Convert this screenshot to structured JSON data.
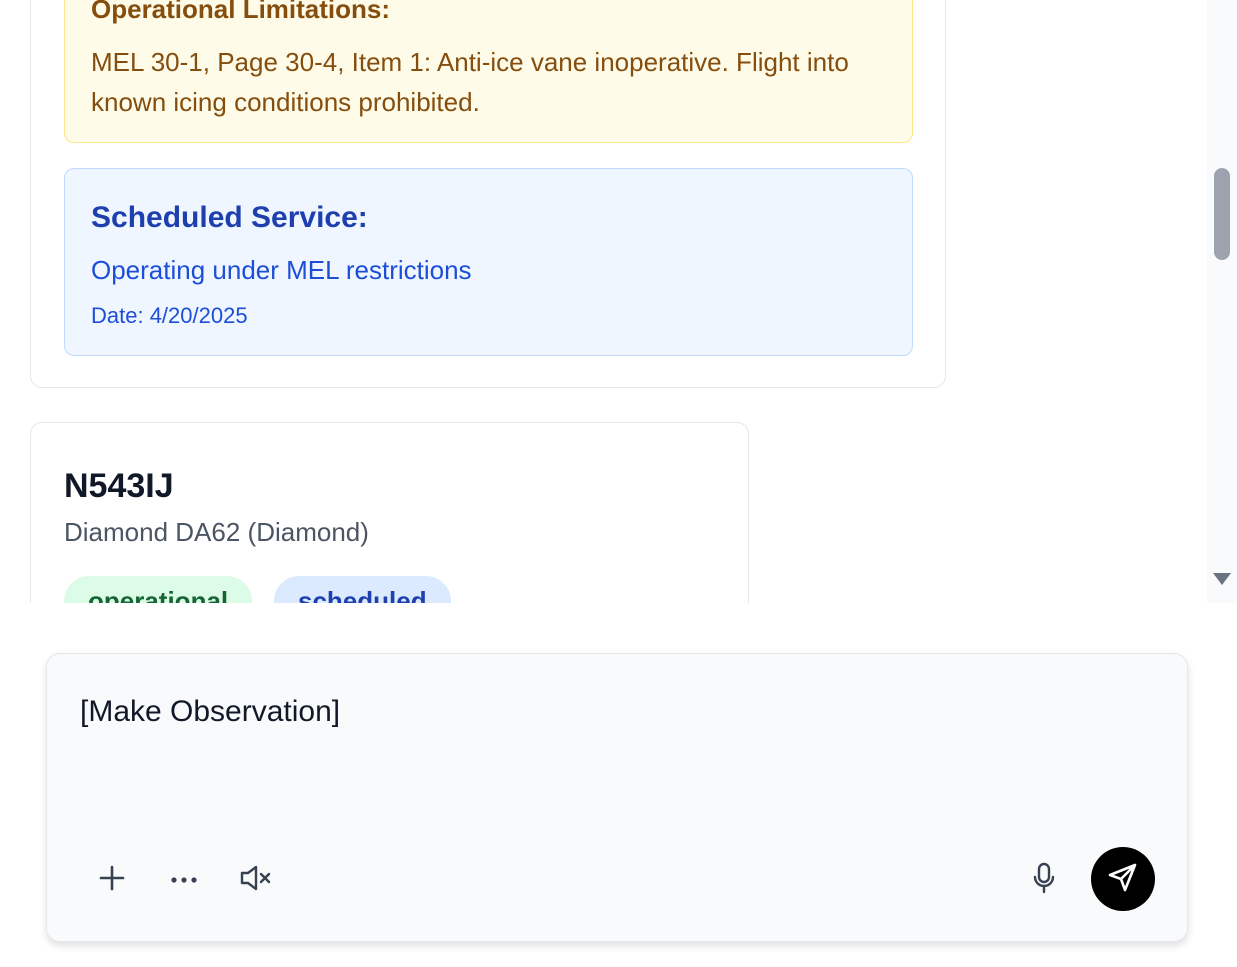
{
  "limitations": {
    "title": "Operational Limitations:",
    "text": "MEL 30-1, Page 30-4, Item 1: Anti-ice vane inoperative. Flight into known icing conditions prohibited."
  },
  "service": {
    "title": "Scheduled Service:",
    "text": "Operating under MEL restrictions",
    "date": "Date: 4/20/2025"
  },
  "aircraft": {
    "tail": "N543IJ",
    "model": "Diamond DA62 (Diamond)",
    "badges": [
      "operational",
      "scheduled"
    ]
  },
  "composer": {
    "value": "[Make Observation]",
    "icons": [
      "plus-icon",
      "more-icon",
      "volume-mute-icon",
      "microphone-icon",
      "send-icon"
    ]
  },
  "colors": {
    "warning_bg": "#fefce8",
    "warning_text": "#854d0e",
    "info_bg": "#eff6ff",
    "info_text": "#1e40af",
    "send_button": "#000000"
  }
}
